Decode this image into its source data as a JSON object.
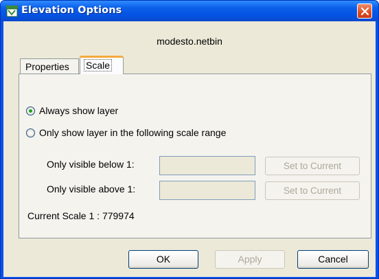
{
  "window": {
    "title": "Elevation Options"
  },
  "dialog": {
    "filename": "modesto.netbin"
  },
  "tabs": [
    {
      "label": "Properties",
      "active": false
    },
    {
      "label": "Scale",
      "active": true
    }
  ],
  "scale": {
    "always_label": "Always show layer",
    "always_checked": true,
    "range_label": "Only show layer in the following scale range",
    "range_checked": false,
    "below_label": "Only visible below 1:",
    "below_value": "",
    "above_label": "Only visible above 1:",
    "above_value": "",
    "set_current_label": "Set to Current",
    "current_scale_text": "Current Scale 1 : 779974"
  },
  "buttons": {
    "ok": "OK",
    "apply": "Apply",
    "cancel": "Cancel"
  },
  "colors": {
    "titlebar": "#0553e3",
    "client_bg": "#ece9d8",
    "close_button": "#de4d22",
    "active_tab_accent": "#f6a93b",
    "disabled_text": "#aca899"
  },
  "icons": {
    "app": "raster-layer-icon",
    "close": "close-icon"
  }
}
